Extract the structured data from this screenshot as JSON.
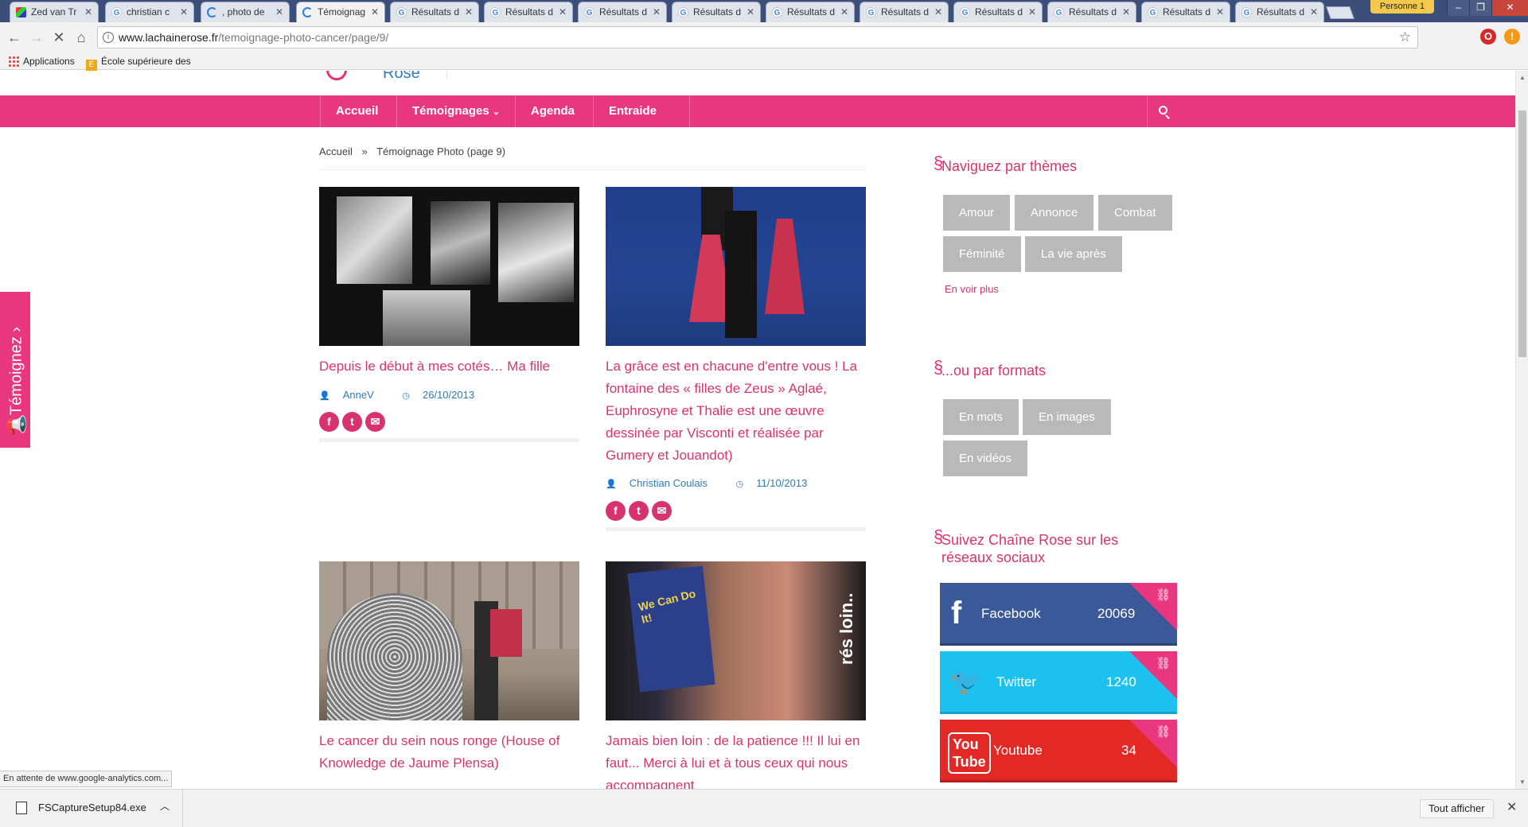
{
  "tabs": [
    {
      "title": "Zed van Tr",
      "icon": "multicolor-icon"
    },
    {
      "title": "christian c",
      "icon": "google-icon"
    },
    {
      "title": ", photo de",
      "icon": "loading-icon"
    },
    {
      "title": "Témoignag",
      "icon": "chainerose-icon",
      "active": true
    },
    {
      "title": "Résultats d",
      "icon": "google-icon"
    },
    {
      "title": "Résultats d",
      "icon": "google-icon"
    },
    {
      "title": "Résultats d",
      "icon": "google-icon"
    },
    {
      "title": "Résultats d",
      "icon": "google-icon"
    },
    {
      "title": "Résultats d",
      "icon": "google-icon"
    },
    {
      "title": "Résultats d",
      "icon": "google-icon"
    },
    {
      "title": "Résultats d",
      "icon": "google-icon"
    },
    {
      "title": "Résultats d",
      "icon": "google-icon"
    },
    {
      "title": "Résultats d",
      "icon": "google-icon"
    },
    {
      "title": "Résultats d",
      "icon": "google-icon"
    }
  ],
  "profile": "Personne 1",
  "address": {
    "domain": "www.lachainerose.fr",
    "path": "/temoignage-photo-cancer/page/9/"
  },
  "bookmarks": {
    "apps": "Applications",
    "school": "École supérieure des"
  },
  "site": {
    "logo_text": "Rose",
    "nav": [
      "Accueil",
      "Témoignages",
      "Agenda",
      "Entraide"
    ],
    "breadcrumb": {
      "home": "Accueil",
      "sep": "»",
      "current": "Témoignage Photo (page 9)"
    }
  },
  "posts": [
    {
      "title": "Depuis le début à mes cotés… Ma fille",
      "author": "AnneV",
      "date": "26/10/2013"
    },
    {
      "title": "La grâce est en chacune d'entre vous ! La fontaine des « filles de Zeus » Aglaé, Euphrosyne et Thalie est une œuvre dessinée par Visconti et réalisée par Gumery et Jouandot)",
      "author": "Christian Coulais",
      "date": "11/10/2013"
    },
    {
      "title": "Le cancer du sein nous ronge (House of Knowledge de Jaume Plensa)"
    },
    {
      "title": "Jamais bien loin : de la patience !!! Il lui en faut... Merci à lui et à tous ceux qui nous accompagnent"
    }
  ],
  "image_texts": {
    "poster": "We Can Do It!",
    "side": "rés loin.."
  },
  "sidebar": {
    "themes_title": "Naviguez par thèmes",
    "themes": [
      "Amour",
      "Annonce",
      "Combat",
      "Féminité",
      "La vie après"
    ],
    "more": "En voir plus",
    "formats_title": "...ou par formats",
    "formats": [
      "En mots",
      "En images",
      "En vidéos"
    ],
    "social_title": "Suivez Chaîne Rose sur les réseaux sociaux",
    "social": [
      {
        "name": "Facebook",
        "count": "20069"
      },
      {
        "name": "Twitter",
        "count": "1240"
      },
      {
        "name": "Youtube",
        "count": "34"
      }
    ]
  },
  "temoignez": "Témoignez",
  "status": "En attente de www.google-analytics.com...",
  "downloads": {
    "file": "FSCaptureSetup84.exe",
    "show_all": "Tout afficher"
  },
  "colors": {
    "brand_pink": "#e8377f",
    "link_blue": "#2f7ab8",
    "facebook": "#3b5998",
    "twitter": "#1dc1ef",
    "youtube": "#e32926"
  }
}
